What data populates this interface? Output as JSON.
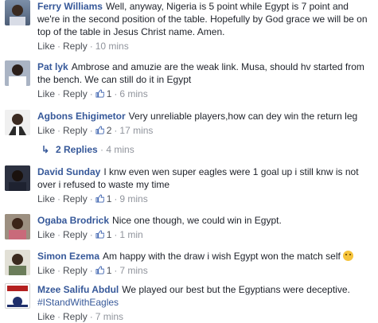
{
  "ui": {
    "like": "Like",
    "reply": "Reply",
    "sep": "·"
  },
  "colors": {
    "name": "#365899",
    "meta": "#90949c",
    "text": "#1d2129"
  },
  "comments": [
    {
      "author": "Ferry Williams",
      "text": "Well, anyway, Nigeria is 5 point while Egypt is 7 point and we're in the second position of the table. Hopefully by God grace we will be on top of the table in Jesus Christ name. Amen.",
      "likes": "",
      "time": "10 mins"
    },
    {
      "author": "Pat lyk",
      "text": "Ambrose and amuzie are the weak link. Musa, should hv started from the bench. We can still do it in Egypt",
      "likes": "1",
      "time": "6 mins"
    },
    {
      "author": "Agbons Ehigimetor",
      "text": "Very unreliable players,how can dey win the return leg",
      "likes": "2",
      "time": "17 mins"
    },
    {
      "author": "David Sunday",
      "text": "I knw even wen super eagles were 1 goal up i still knw is not over i refused to waste my time",
      "likes": "1",
      "time": "9 mins"
    },
    {
      "author": "Ogaba Brodrick",
      "text": "Nice one though, we could win in Egypt.",
      "likes": "1",
      "time": "1 min"
    },
    {
      "author": "Simon Ezema",
      "text": "Am happy with the draw i wish Egypt won the match self",
      "likes": "1",
      "time": "7 mins"
    },
    {
      "author": "Mzee Salifu Abdul",
      "text": "We played our best but the Egyptians were deceptive.",
      "hashtag": "#IStandWithEagles",
      "likes": "",
      "time": "7 mins"
    }
  ],
  "replies_link": {
    "label": "2 Replies",
    "time": "4 mins"
  }
}
